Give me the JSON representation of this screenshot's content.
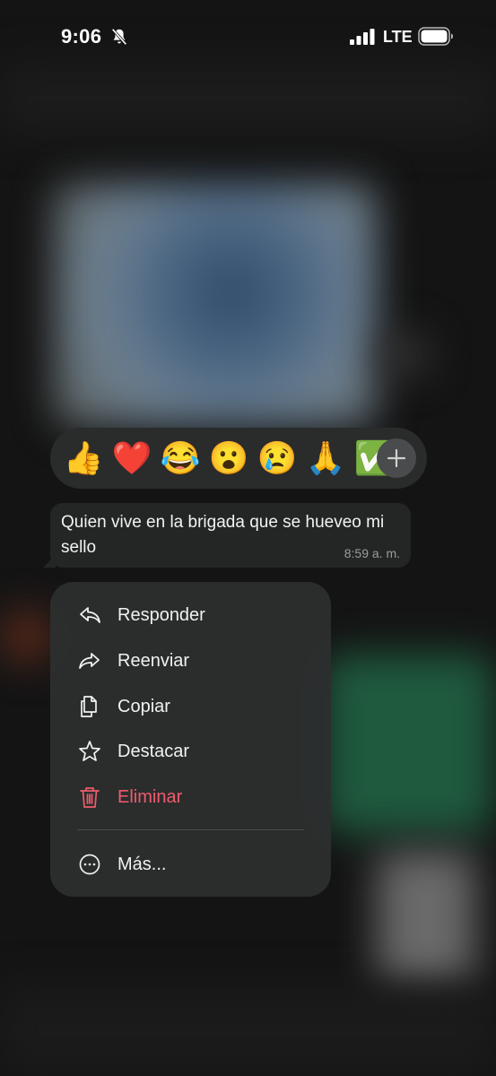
{
  "status_bar": {
    "time": "9:06",
    "network": "LTE",
    "icons": [
      "bell-slash-icon",
      "signal-icon",
      "battery-icon"
    ]
  },
  "reactions": {
    "emojis": [
      "👍",
      "❤️",
      "😂",
      "😮",
      "😢",
      "🙏",
      "✅"
    ],
    "more_icon": "plus-icon"
  },
  "message": {
    "text": "Quien vive en la brigada que se hueveo mi sello",
    "time": "8:59 a. m."
  },
  "menu": {
    "items": [
      {
        "label": "Responder",
        "icon": "reply-icon"
      },
      {
        "label": "Reenviar",
        "icon": "forward-icon"
      },
      {
        "label": "Copiar",
        "icon": "copy-icon"
      },
      {
        "label": "Destacar",
        "icon": "star-icon"
      },
      {
        "label": "Eliminar",
        "icon": "trash-icon"
      },
      {
        "label": "Más...",
        "icon": "more-icon"
      }
    ]
  },
  "colors": {
    "danger": "#ef5c6c",
    "menu_bg": "#2c2e2e",
    "bubble_bg": "#242626"
  }
}
